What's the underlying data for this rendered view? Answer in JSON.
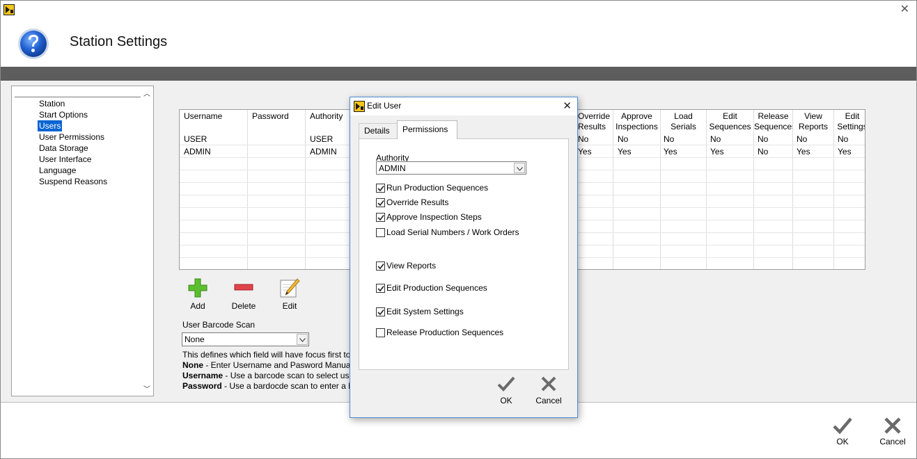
{
  "window": {
    "title": "Station Settings",
    "close_glyph": "✕"
  },
  "nav": {
    "items": [
      {
        "label": "Station",
        "selected": false
      },
      {
        "label": "Start Options",
        "selected": false
      },
      {
        "label": "Users",
        "selected": true
      },
      {
        "label": "User Permissions",
        "selected": false
      },
      {
        "label": "Data Storage",
        "selected": false
      },
      {
        "label": "User Interface",
        "selected": false
      },
      {
        "label": "Language",
        "selected": false
      },
      {
        "label": "Suspend Reasons",
        "selected": false
      }
    ]
  },
  "users_table": {
    "headers": {
      "username": "Username",
      "password": "Password",
      "authority": "Authority",
      "override_1": "Override",
      "override_2": "Results",
      "approve_1": "Approve",
      "approve_2": "Inspections",
      "load_1": "Load",
      "load_2": "Serials",
      "editseq_1": "Edit",
      "editseq_2": "Sequences",
      "release_1": "Release",
      "release_2": "Sequences",
      "view_1": "View",
      "view_2": "Reports",
      "editset_1": "Edit",
      "editset_2": "Settings"
    },
    "rows": [
      {
        "username": "USER",
        "authority": "USER",
        "override": "No",
        "approve": "No",
        "load": "No",
        "editseq": "No",
        "release": "No",
        "view": "No",
        "editset": "No"
      },
      {
        "username": "ADMIN",
        "authority": "ADMIN",
        "override": "Yes",
        "approve": "Yes",
        "load": "Yes",
        "editseq": "Yes",
        "release": "No",
        "view": "Yes",
        "editset": "Yes"
      }
    ]
  },
  "toolbar": {
    "add_label": "Add",
    "delete_label": "Delete",
    "edit_label": "Edit"
  },
  "barcode": {
    "label": "User Barcode Scan",
    "value": "None",
    "description_intro": "This defines which field will have focus first to",
    "none_term": "None",
    "none_desc": " - Enter Username and Pasword Manuall",
    "username_term": "Username",
    "username_desc": " - Use a barcode scan to select user",
    "password_term": "Password",
    "password_desc": " - Use a bardocde scan to enter a Pa"
  },
  "footer": {
    "ok_label": "OK",
    "cancel_label": "Cancel"
  },
  "dialog": {
    "title": "Edit User",
    "close_glyph": "✕",
    "tabs": [
      "Details",
      "Permissions"
    ],
    "active_tab": "Permissions",
    "authority_label": "Authority",
    "authority_value": "ADMIN",
    "permissions": [
      {
        "label": "Run Production Sequences",
        "checked": true
      },
      {
        "label": "Override Results",
        "checked": true
      },
      {
        "label": "Approve Inspection Steps",
        "checked": true
      },
      {
        "label": "Load Serial Numbers / Work Orders",
        "checked": false
      },
      {
        "label": "View Reports",
        "checked": true
      },
      {
        "label": "Edit Production Sequences",
        "checked": true
      },
      {
        "label": "Edit System Settings",
        "checked": true
      },
      {
        "label": "Release Production Sequences",
        "checked": false
      }
    ],
    "ok_label": "OK",
    "cancel_label": "Cancel"
  },
  "colors": {
    "selection": "#0a64d2",
    "title_bar_dark": "#5d5d5d",
    "add_green": "#4caf2a",
    "delete_red": "#d9363e",
    "check_gray": "#6a6a6a"
  }
}
